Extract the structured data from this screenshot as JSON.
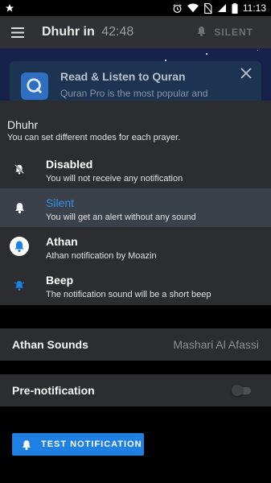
{
  "status_bar": {
    "time": "11:13",
    "icons": [
      "notification-star-icon",
      "alarm-icon",
      "wifi-icon",
      "no-sim-icon",
      "signal-icon",
      "battery-icon"
    ]
  },
  "app_bar": {
    "prayer": "Dhuhr in",
    "countdown": "42:48",
    "mode_label": "SILENT"
  },
  "promo": {
    "title": "Read & Listen to Quran",
    "text": "Quran Pro is the most popular and"
  },
  "mode_sheet": {
    "title": "Dhuhr",
    "subtitle": "You can set different modes for each prayer.",
    "modes": [
      {
        "label": "Disabled",
        "desc": "You will not receive any notification",
        "icon": "bell-off-icon",
        "selected": false
      },
      {
        "label": "Silent",
        "desc": "You will get an alert without any sound",
        "icon": "bell-icon",
        "selected": true
      },
      {
        "label": "Athan",
        "desc": "Athan notification by Moazin",
        "icon": "athan-bell-icon",
        "selected": false
      },
      {
        "label": "Beep",
        "desc": "The notification sound will be a short beep",
        "icon": "beep-bell-icon",
        "selected": false
      }
    ]
  },
  "athan_sounds": {
    "label": "Athan Sounds",
    "value": "Mashari Al Afassi"
  },
  "pre_notification": {
    "label": "Pre-notification",
    "enabled": false
  },
  "test_button": {
    "label": "TEST NOTIFICATION"
  },
  "colors": {
    "accent": "#1e80e3",
    "selected_label": "#2f8fe8",
    "surface": "#2c2d30",
    "app_bar": "#2f3134"
  }
}
